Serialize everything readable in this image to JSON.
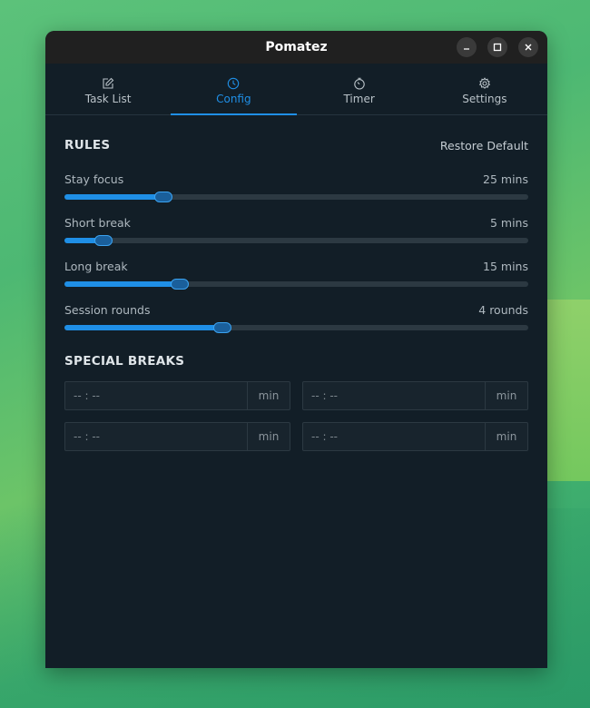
{
  "window": {
    "title": "Pomatez"
  },
  "tabs": [
    {
      "label": "Task List",
      "icon": "edit-icon",
      "active": false
    },
    {
      "label": "Config",
      "icon": "clock-icon",
      "active": true
    },
    {
      "label": "Timer",
      "icon": "stopwatch-icon",
      "active": false
    },
    {
      "label": "Settings",
      "icon": "gear-icon",
      "active": false
    }
  ],
  "rules": {
    "title": "RULES",
    "restore_label": "Restore Default",
    "sliders": [
      {
        "label": "Stay focus",
        "value_text": "25 mins",
        "fraction": 0.213
      },
      {
        "label": "Short break",
        "value_text": "5 mins",
        "fraction": 0.084
      },
      {
        "label": "Long break",
        "value_text": "15 mins",
        "fraction": 0.249
      },
      {
        "label": "Session rounds",
        "value_text": "4 rounds",
        "fraction": 0.34
      }
    ]
  },
  "special": {
    "title": "SPECIAL BREAKS",
    "inputs": [
      {
        "value": "-- : --",
        "unit": "min"
      },
      {
        "value": "-- : --",
        "unit": "min"
      },
      {
        "value": "-- : --",
        "unit": "min"
      },
      {
        "value": "-- : --",
        "unit": "min"
      }
    ]
  },
  "colors": {
    "accent": "#1f8fe6",
    "window_bg": "#121e27",
    "titlebar_bg": "#202020"
  }
}
